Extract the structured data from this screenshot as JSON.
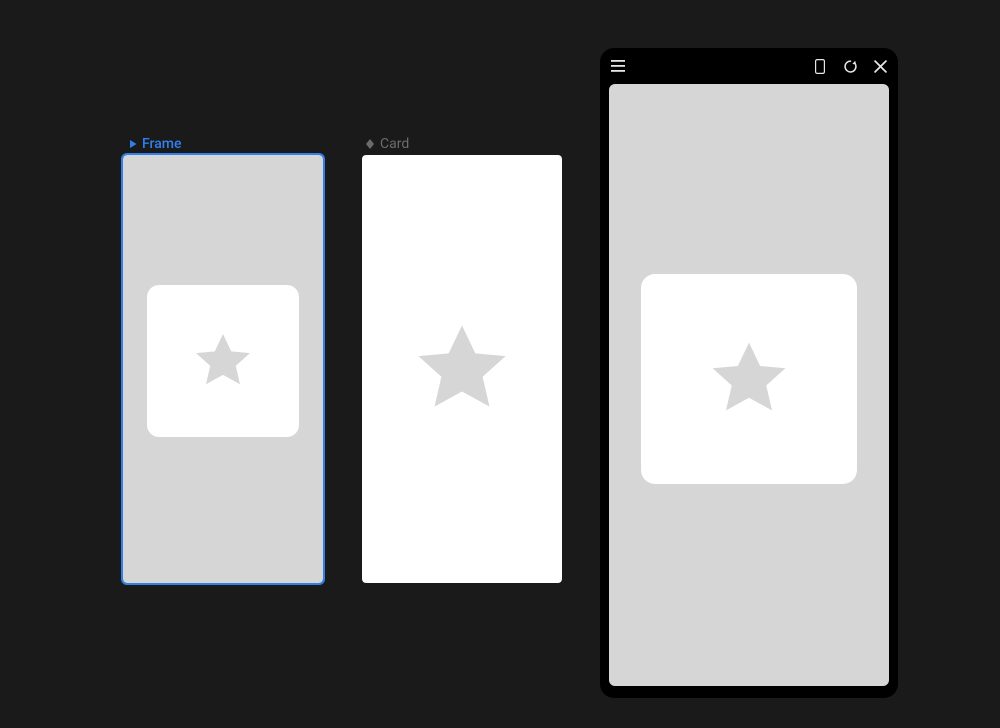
{
  "canvas": {
    "frame_label": "Frame",
    "card_label": "Card"
  },
  "preview": {
    "icons": {
      "menu": "menu",
      "device": "device",
      "restart": "restart",
      "close": "close"
    }
  },
  "colors": {
    "selection": "#2f80ed",
    "artboard_bg": "#d6d6d6",
    "card_bg": "#ffffff",
    "canvas_bg": "#1a1a1a"
  }
}
